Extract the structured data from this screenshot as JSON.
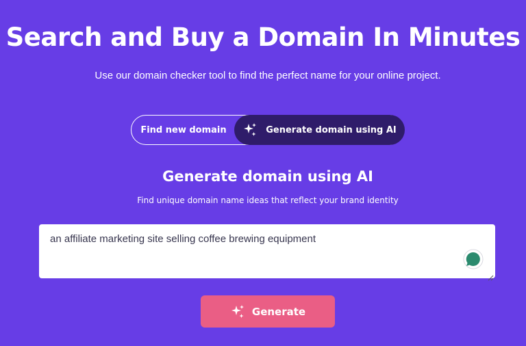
{
  "hero": {
    "title": "Search and Buy a Domain In Minutes",
    "subtitle": "Use our domain checker tool to find the perfect name for your online project."
  },
  "mode_toggle": {
    "options": [
      {
        "label": "Find new domain",
        "selected": false
      },
      {
        "label": "Generate domain using AI",
        "selected": true,
        "icon": "sparkles-icon"
      }
    ]
  },
  "ai_section": {
    "title": "Generate domain using AI",
    "subtitle": "Find unique domain name ideas that reflect your brand identity"
  },
  "prompt": {
    "value": "an affiliate marketing site selling coffee brewing equipment"
  },
  "generate_button": {
    "label": "Generate",
    "icon": "sparkles-icon"
  },
  "colors": {
    "background": "#673de6",
    "selected_toggle": "#2f1c6a",
    "generate_button": "#ea5e85",
    "assist_icon": "#2b8a6e"
  }
}
